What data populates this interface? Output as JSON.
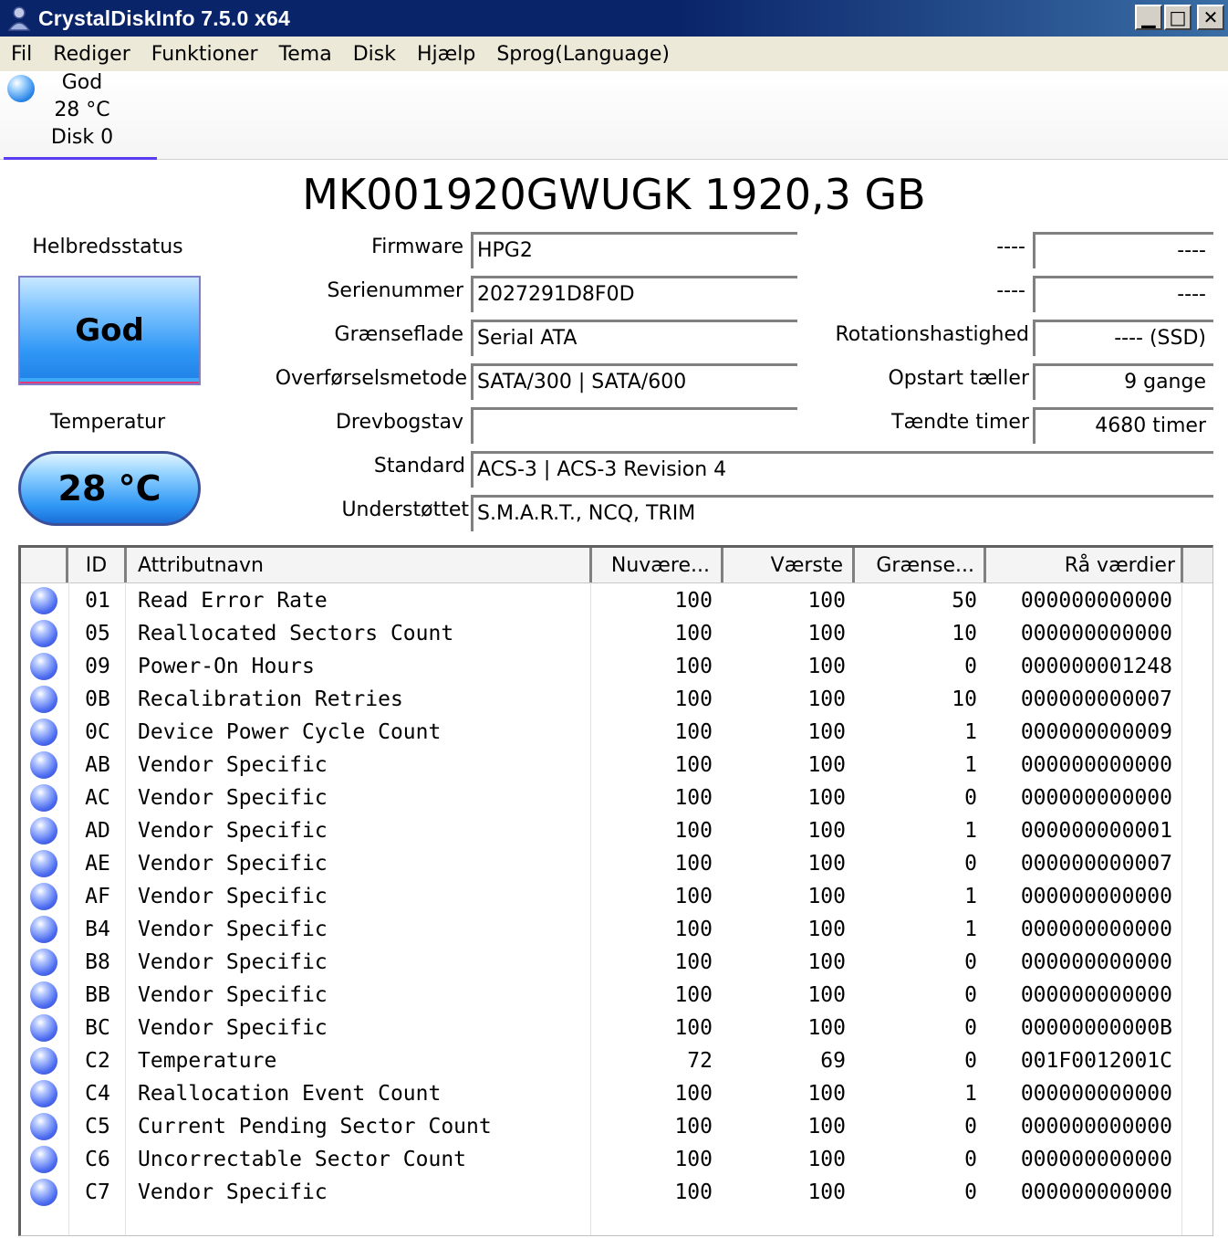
{
  "window": {
    "title": "CrystalDiskInfo 7.5.0 x64",
    "buttons": {
      "minimize": "▁",
      "maximize": "□",
      "close": "✕"
    }
  },
  "menu": [
    "Fil",
    "Rediger",
    "Funktioner",
    "Tema",
    "Disk",
    "Hjælp",
    "Sprog(Language)"
  ],
  "disk_tab": {
    "status": "God",
    "temp": "28 °C",
    "name": "Disk 0"
  },
  "model": "MK001920GWUGK 1920,3 GB",
  "health": {
    "label": "Helbredsstatus",
    "value": "God"
  },
  "temperature": {
    "label": "Temperatur",
    "value": "28 °C"
  },
  "info": {
    "firmware": {
      "label": "Firmware",
      "value": "HPG2"
    },
    "serial": {
      "label": "Serienummer",
      "value": "2027291D8F0D"
    },
    "interface": {
      "label": "Grænseflade",
      "value": "Serial ATA"
    },
    "transfer": {
      "label": "Overførselsmetode",
      "value": "SATA/300 | SATA/600"
    },
    "drive_letter": {
      "label": "Drevbogstav",
      "value": ""
    },
    "standard": {
      "label": "Standard",
      "value": "ACS-3 | ACS-3 Revision 4"
    },
    "supported": {
      "label": "Understøttet",
      "value": "S.M.A.R.T., NCQ, TRIM"
    },
    "right1": {
      "label": "----",
      "value": "----"
    },
    "right2": {
      "label": "----",
      "value": "----"
    },
    "rotation": {
      "label": "Rotationshastighed",
      "value": "---- (SSD)"
    },
    "power_count": {
      "label": "Opstart tæller",
      "value": "9 gange"
    },
    "power_hours": {
      "label": "Tændte timer",
      "value": "4680 timer"
    }
  },
  "table": {
    "columns": [
      "ID",
      "Attributnavn",
      "Nuvære...",
      "Værste",
      "Grænse...",
      "Rå værdier"
    ],
    "rows": [
      [
        "01",
        "Read Error Rate",
        "100",
        "100",
        "50",
        "000000000000"
      ],
      [
        "05",
        "Reallocated Sectors Count",
        "100",
        "100",
        "10",
        "000000000000"
      ],
      [
        "09",
        "Power-On Hours",
        "100",
        "100",
        "0",
        "000000001248"
      ],
      [
        "0B",
        "Recalibration Retries",
        "100",
        "100",
        "10",
        "000000000007"
      ],
      [
        "0C",
        "Device Power Cycle Count",
        "100",
        "100",
        "1",
        "000000000009"
      ],
      [
        "AB",
        "Vendor Specific",
        "100",
        "100",
        "1",
        "000000000000"
      ],
      [
        "AC",
        "Vendor Specific",
        "100",
        "100",
        "0",
        "000000000000"
      ],
      [
        "AD",
        "Vendor Specific",
        "100",
        "100",
        "1",
        "000000000001"
      ],
      [
        "AE",
        "Vendor Specific",
        "100",
        "100",
        "0",
        "000000000007"
      ],
      [
        "AF",
        "Vendor Specific",
        "100",
        "100",
        "1",
        "000000000000"
      ],
      [
        "B4",
        "Vendor Specific",
        "100",
        "100",
        "1",
        "000000000000"
      ],
      [
        "B8",
        "Vendor Specific",
        "100",
        "100",
        "0",
        "000000000000"
      ],
      [
        "BB",
        "Vendor Specific",
        "100",
        "100",
        "0",
        "000000000000"
      ],
      [
        "BC",
        "Vendor Specific",
        "100",
        "100",
        "0",
        "00000000000B"
      ],
      [
        "C2",
        "Temperature",
        "72",
        "69",
        "0",
        "001F0012001C"
      ],
      [
        "C4",
        "Reallocation Event Count",
        "100",
        "100",
        "1",
        "000000000000"
      ],
      [
        "C5",
        "Current Pending Sector Count",
        "100",
        "100",
        "0",
        "000000000000"
      ],
      [
        "C6",
        "Uncorrectable Sector Count",
        "100",
        "100",
        "0",
        "000000000000"
      ],
      [
        "C7",
        "Vendor Specific",
        "100",
        "100",
        "0",
        "000000000000"
      ]
    ]
  }
}
